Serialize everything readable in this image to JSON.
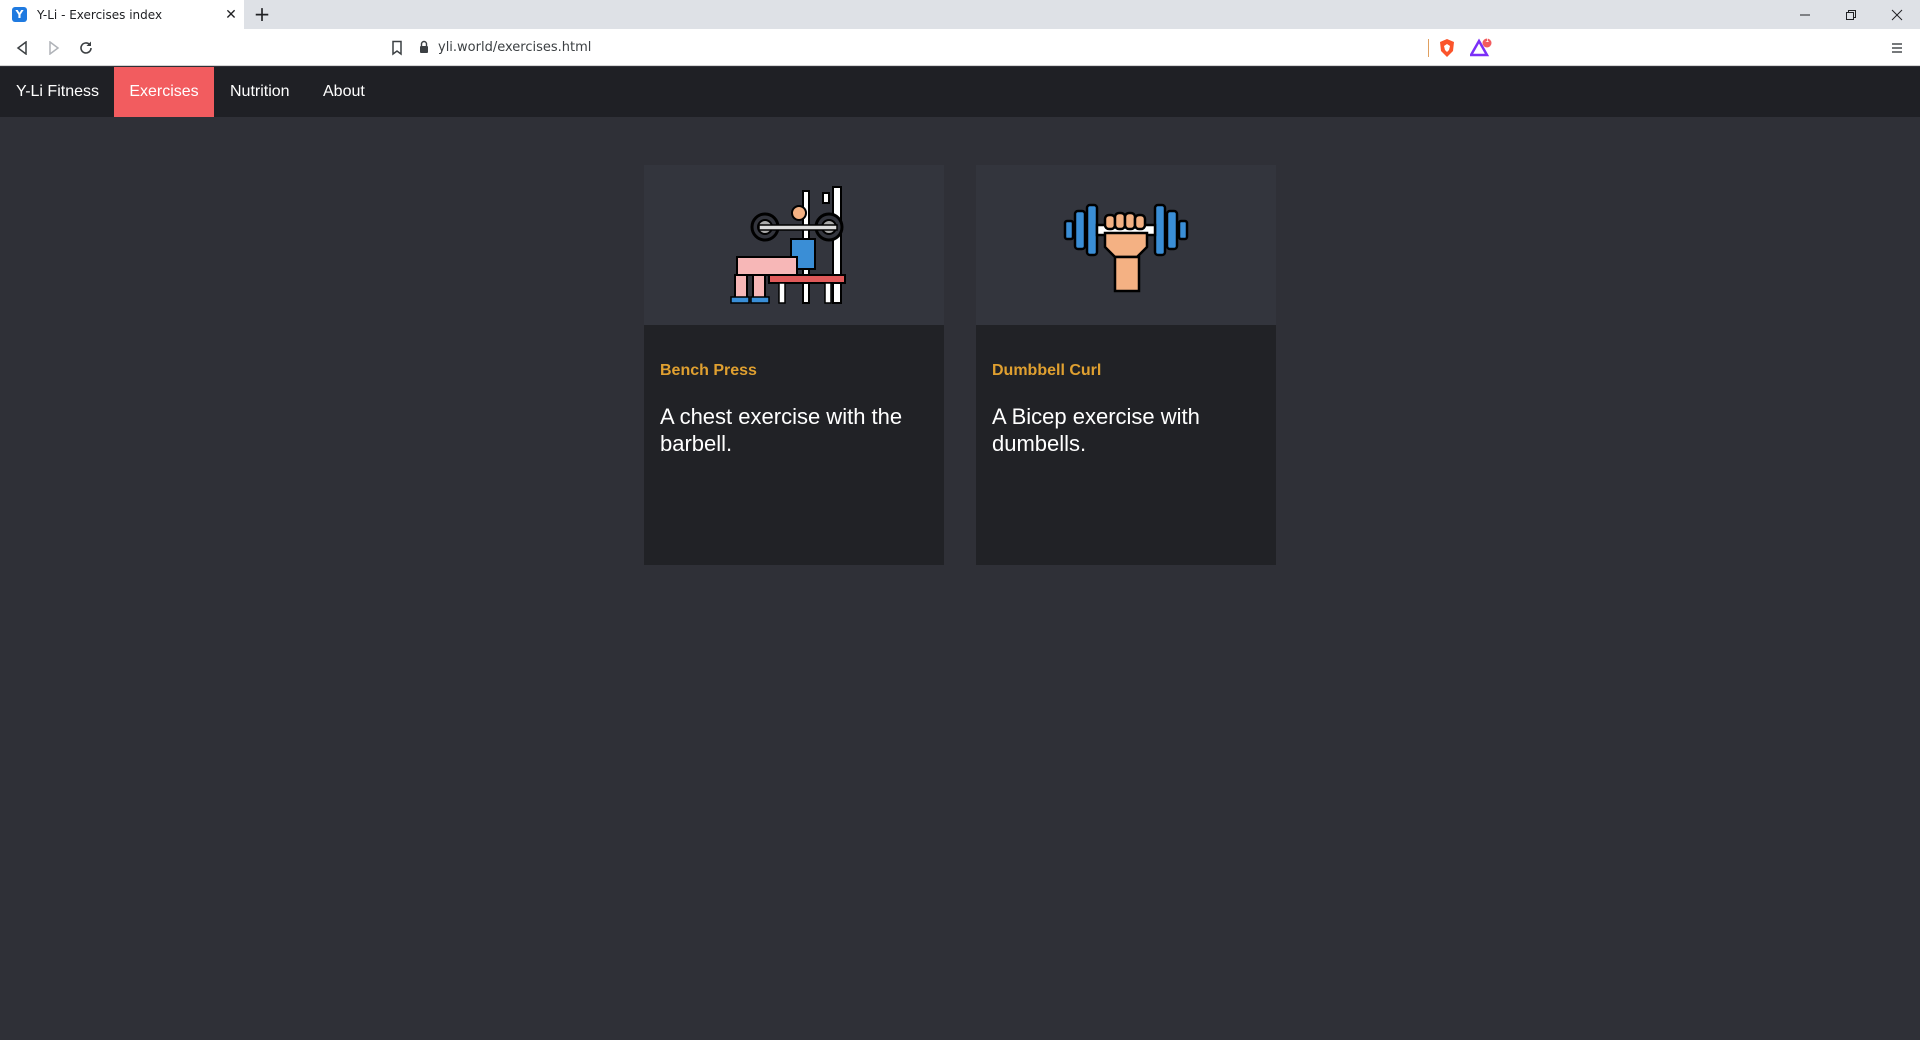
{
  "browser": {
    "tab_title": "Y-Li - Exercises index",
    "favicon_letter": "Y",
    "url": "yli.world/exercises.html",
    "ext_badge_count": "1",
    "colors": {
      "favicon": "#1f7ae0",
      "brave": "#fb542b",
      "rewards": "#7b2ff7"
    }
  },
  "nav": {
    "brand": "Y-Li Fitness",
    "items": [
      {
        "label": "Exercises",
        "active": true
      },
      {
        "label": "Nutrition",
        "active": false
      },
      {
        "label": "About",
        "active": false
      }
    ],
    "colors": {
      "bar": "#1f2025",
      "active": "#f25c5f"
    }
  },
  "cards": [
    {
      "title": "Bench Press",
      "description": "A chest exercise with the barbell.",
      "icon": "bench-press-icon"
    },
    {
      "title": "Dumbbell Curl",
      "description": "A Bicep exercise with dumbells.",
      "icon": "dumbbell-curl-icon"
    }
  ],
  "colors": {
    "page_bg": "#2f3037",
    "card_bg": "#212226",
    "card_media_bg": "#33353d",
    "card_title": "#e0a030"
  }
}
